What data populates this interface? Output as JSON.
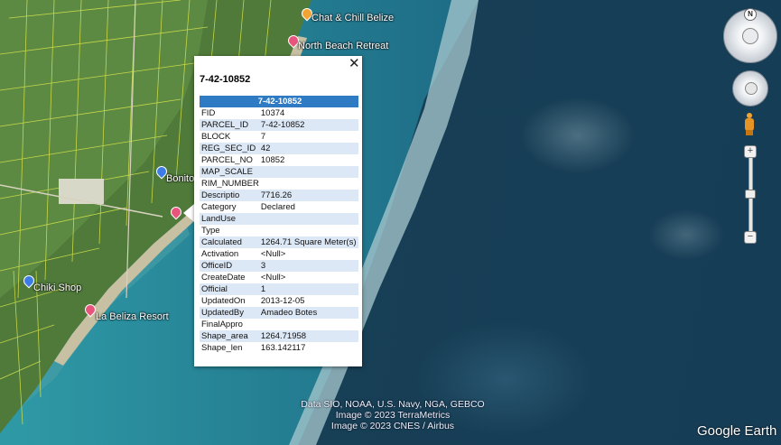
{
  "map": {
    "places": [
      {
        "name": "Chat & Chill Belize",
        "icon": "orange-pin-icon"
      },
      {
        "name": "North Beach Retreat",
        "icon": "red-pin-icon"
      },
      {
        "name": "Bonito",
        "icon": "blue-pin-icon"
      },
      {
        "name": "Chiki Shop",
        "icon": "blue-pin-icon"
      },
      {
        "name": "La Beliza Resort",
        "icon": "red-pin-icon"
      }
    ],
    "attribution": [
      "Data SIO, NOAA, U.S. Navy, NGA, GEBCO",
      "Image © 2023 TerraMetrics",
      "Image © 2023 CNES / Airbus"
    ],
    "logo": "Google Earth"
  },
  "balloon": {
    "title": "7-42-10852",
    "close_label": "✕",
    "header": "7-42-10852",
    "rows": [
      {
        "key": "FID",
        "value": "10374"
      },
      {
        "key": "PARCEL_ID",
        "value": "7-42-10852"
      },
      {
        "key": "BLOCK",
        "value": "7"
      },
      {
        "key": "REG_SEC_ID",
        "value": "42"
      },
      {
        "key": "PARCEL_NO",
        "value": "10852"
      },
      {
        "key": "MAP_SCALE",
        "value": ""
      },
      {
        "key": "RIM_NUMBER",
        "value": ""
      },
      {
        "key": "Descriptio",
        "value": "7716.26"
      },
      {
        "key": "Category",
        "value": "Declared"
      },
      {
        "key": "LandUse",
        "value": ""
      },
      {
        "key": "Type",
        "value": ""
      },
      {
        "key": "Calculated",
        "value": "1264.71 Square Meter(s)"
      },
      {
        "key": "Activation",
        "value": "<Null>"
      },
      {
        "key": "OfficeID",
        "value": "3"
      },
      {
        "key": "CreateDate",
        "value": "<Null>"
      },
      {
        "key": "Official",
        "value": "1"
      },
      {
        "key": "UpdatedOn",
        "value": "2013-12-05"
      },
      {
        "key": "UpdatedBy",
        "value": "Amadeo Botes"
      },
      {
        "key": "FinalAppro",
        "value": ""
      },
      {
        "key": "Shape_area",
        "value": "1264.71958"
      },
      {
        "key": "Shape_len",
        "value": "163.142117"
      }
    ]
  },
  "nav": {
    "compass_north": "N",
    "zoom_in": "+",
    "zoom_out": "−"
  },
  "colors": {
    "table_header": "#2e7bc4",
    "table_alt_row": "#dde8f6",
    "parcel_lines": "#d9e64a"
  }
}
